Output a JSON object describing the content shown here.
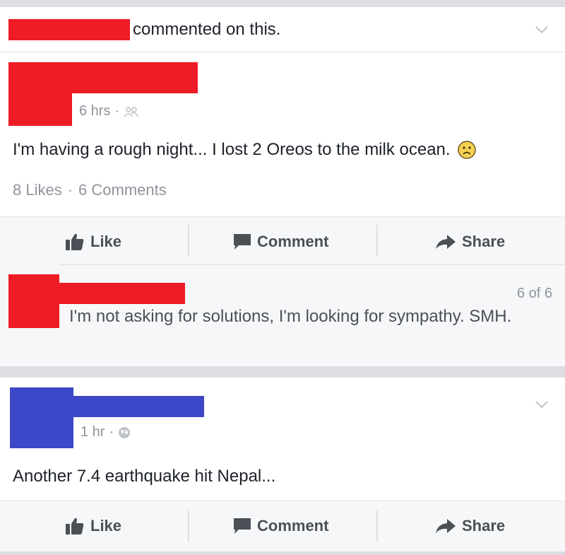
{
  "story": {
    "header_suffix": "commented on this.",
    "timestamp": "6 hrs",
    "dot": "·",
    "audience_icon": "friends-icon",
    "post_text": "I'm having a rough night... I lost 2 Oreos to the milk ocean.",
    "emoji": "frowning-face-emoji",
    "likes": "8 Likes",
    "comments": "6 Comments",
    "actions": {
      "like": "Like",
      "comment": "Comment",
      "share": "Share"
    },
    "comment": {
      "counter": "6 of 6",
      "text": "I'm not asking for solutions, I'm looking for sympathy. SMH."
    },
    "redaction_color": "#ee1c25"
  },
  "story2": {
    "timestamp": "1 hr",
    "dot": "·",
    "audience_icon": "globe-icon",
    "post_text": "Another 7.4 earthquake hit Nepal...",
    "actions": {
      "like": "Like",
      "comment": "Comment",
      "share": "Share"
    },
    "redaction_color": "#3c48c8"
  }
}
